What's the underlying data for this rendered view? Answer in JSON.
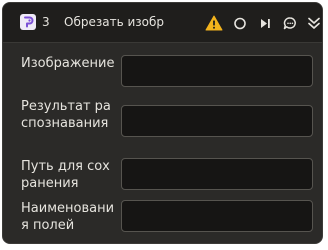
{
  "header": {
    "node_number": "3",
    "title": "Обрезать изобр",
    "icons": [
      "node-logo-icon",
      "warning-icon",
      "circle-icon",
      "skip-forward-icon",
      "chat-bubble-icon",
      "chevrons-down-icon"
    ],
    "colors": {
      "warning": "#f3b31c",
      "logo_bg": "#efeaf7",
      "logo_accent": "#7b4fd6"
    }
  },
  "fields": [
    {
      "label": "Изображение",
      "value": ""
    },
    {
      "label": "Результат распознавания",
      "value": ""
    },
    {
      "label": "Путь для сохранения",
      "value": ""
    },
    {
      "label": "Наименования полей",
      "value": ""
    }
  ]
}
